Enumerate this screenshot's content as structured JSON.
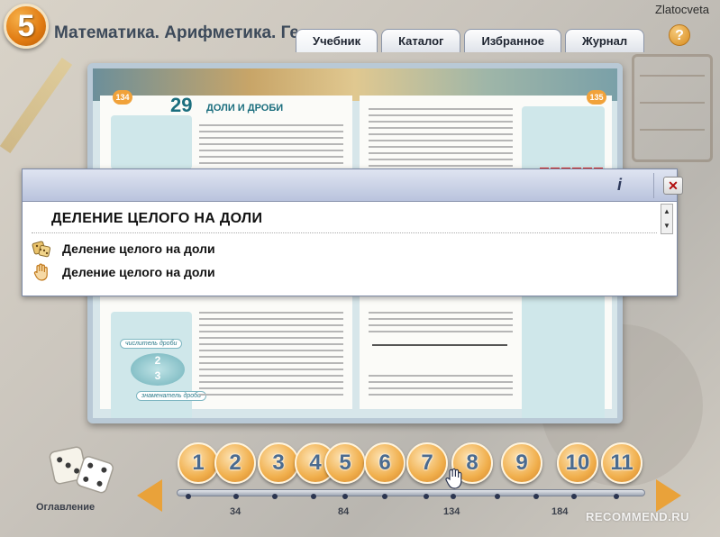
{
  "header": {
    "logo_digit": "5",
    "app_title": "Математика. Арифметика. Геометрия",
    "user_name": "Zlatocveta",
    "help_label": "?",
    "tabs": [
      {
        "label": "Учебник"
      },
      {
        "label": "Каталог"
      },
      {
        "label": "Избранное"
      },
      {
        "label": "Журнал"
      }
    ]
  },
  "book": {
    "left_page_num": "134",
    "right_page_num": "135",
    "chapter_number": "29",
    "chapter_title": "ДОЛИ И ДРОБИ",
    "tag_numerator": "числитель дроби",
    "tag_denominator": "знаменатель дроби",
    "fraction_top": "2",
    "fraction_bottom": "3"
  },
  "popup": {
    "info_label": "i",
    "close_label": "✕",
    "heading": "ДЕЛЕНИЕ ЦЕЛОГО НА ДОЛИ",
    "items": [
      {
        "icon": "dice-icon",
        "label": "Деление целого на доли"
      },
      {
        "icon": "hand-icon",
        "label": "Деление целого на доли"
      }
    ]
  },
  "navigation": {
    "contents_label": "Оглавление",
    "chapters": [
      "1",
      "2",
      "3",
      "4",
      "5",
      "6",
      "7",
      "8",
      "9",
      "10",
      "11"
    ],
    "page_marks": [
      "34",
      "84",
      "134",
      "184"
    ]
  },
  "watermark": "RECOMMEND.RU",
  "colors": {
    "accent_orange": "#f0ae4b",
    "teal": "#1b6e7e",
    "close_red": "#b10d0d"
  }
}
